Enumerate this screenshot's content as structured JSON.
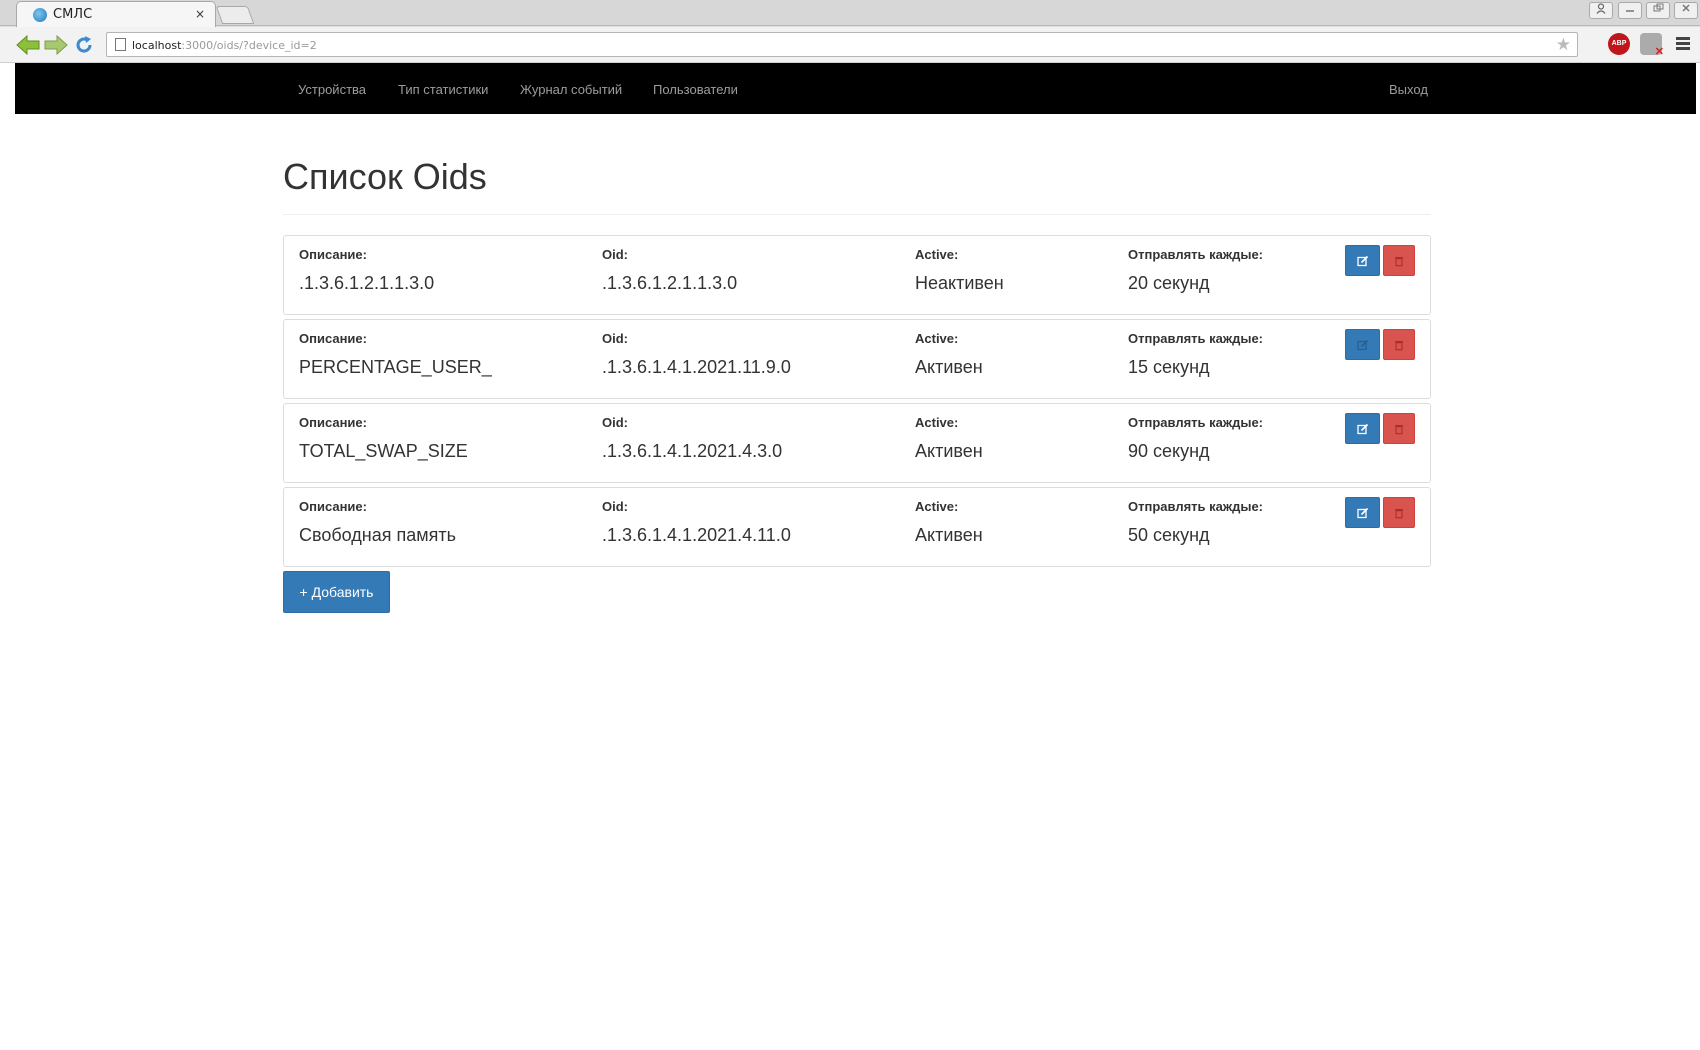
{
  "browser": {
    "tab_title": "СМЛС",
    "tab_close": "×",
    "url_host": "localhost",
    "url_rest": ":3000/oids/?device_id=2",
    "abp_label": "ABP"
  },
  "navbar": {
    "items": [
      {
        "label": "Устройства"
      },
      {
        "label": "Тип статистики"
      },
      {
        "label": "Журнал событий"
      },
      {
        "label": "Пользователи"
      }
    ],
    "logout_label": "Выход"
  },
  "page": {
    "title": "Список Oids",
    "labels": {
      "description": "Описание:",
      "oid": "Oid:",
      "active": "Active:",
      "interval": "Отправлять каждые:"
    },
    "rows": [
      {
        "description": ".1.3.6.1.2.1.1.3.0",
        "oid": ".1.3.6.1.2.1.1.3.0",
        "active": "Неактивен",
        "interval": "20 секунд"
      },
      {
        "description": "PERCENTAGE_USER_",
        "oid": ".1.3.6.1.4.1.2021.11.9.0",
        "active": "Активен",
        "interval": "15 секунд"
      },
      {
        "description": "TOTAL_SWAP_SIZE",
        "oid": ".1.3.6.1.4.1.2021.4.3.0",
        "active": "Активен",
        "interval": "90 секунд"
      },
      {
        "description": "Свободная память",
        "oid": ".1.3.6.1.4.1.2021.4.11.0",
        "active": "Активен",
        "interval": "50 секунд"
      }
    ],
    "add_button_label": "+ Добавить"
  },
  "colors": {
    "primary": "#337ab7",
    "danger": "#d9534f",
    "navbar_bg": "#000000",
    "nav_text": "#9d9d9d"
  },
  "icons": {
    "edit": "edit-icon",
    "delete": "trash-icon"
  }
}
